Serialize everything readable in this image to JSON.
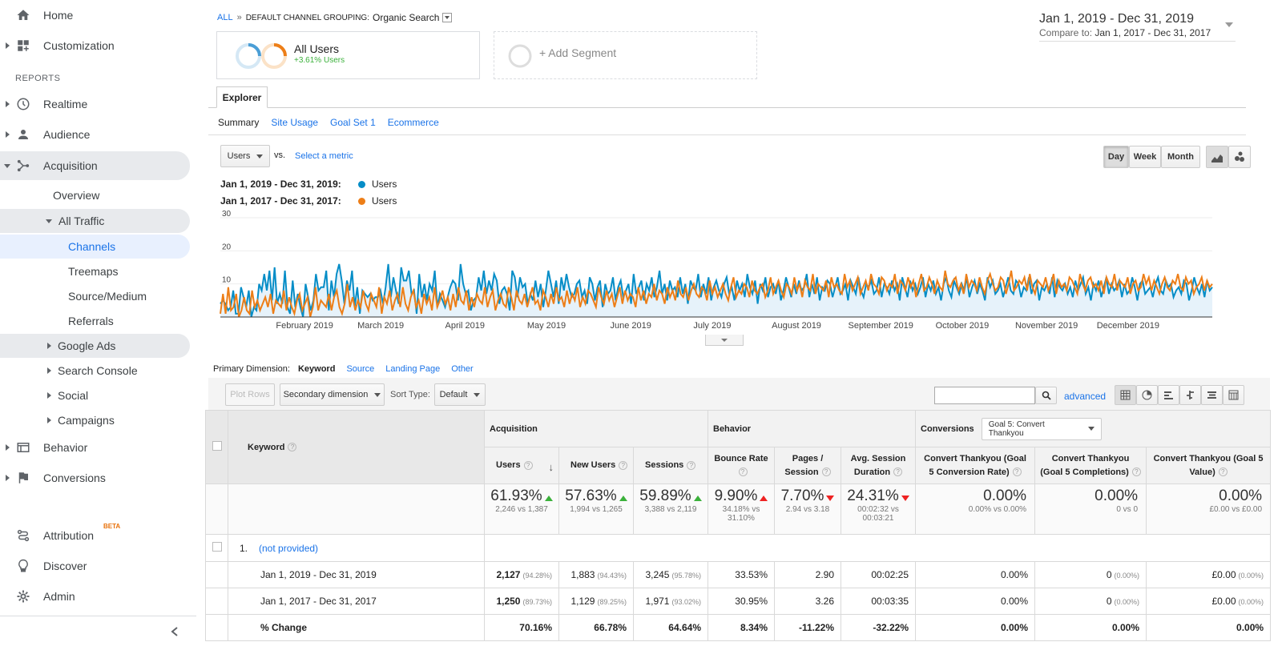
{
  "sidebar": {
    "home": "Home",
    "customization": "Customization",
    "reports_header": "REPORTS",
    "realtime": "Realtime",
    "audience": "Audience",
    "acquisition": "Acquisition",
    "overview": "Overview",
    "all_traffic": "All Traffic",
    "channels": "Channels",
    "treemaps": "Treemaps",
    "source_medium": "Source/Medium",
    "referrals": "Referrals",
    "google_ads": "Google Ads",
    "search_console": "Search Console",
    "social": "Social",
    "campaigns": "Campaigns",
    "behavior": "Behavior",
    "conversions": "Conversions",
    "attribution": "Attribution",
    "attribution_badge": "BETA",
    "discover": "Discover",
    "admin": "Admin"
  },
  "breadcrumb": {
    "all": "ALL",
    "sep": "»",
    "grouping_label": "DEFAULT CHANNEL GROUPING:",
    "grouping_value": "Organic Search"
  },
  "segment": {
    "name": "All Users",
    "pct": "+3.61% Users",
    "add": "+ Add Segment"
  },
  "daterange": {
    "main": "Jan 1, 2019 - Dec 31, 2019",
    "compare_label": "Compare to:",
    "compare_value": "Jan 1, 2017 - Dec 31, 2017"
  },
  "tabs": {
    "explorer": "Explorer",
    "summary": "Summary",
    "site_usage": "Site Usage",
    "goal_set": "Goal Set 1",
    "ecommerce": "Ecommerce"
  },
  "controls": {
    "metric": "Users",
    "vs": "vs.",
    "select_metric": "Select a metric",
    "day": "Day",
    "week": "Week",
    "month": "Month"
  },
  "legend": {
    "range1": "Jan 1, 2019 - Dec 31, 2019:",
    "range2": "Jan 1, 2017 - Dec 31, 2017:",
    "series1": "Users",
    "series2": "Users",
    "color1": "#058dc7",
    "color2": "#ed7e17"
  },
  "chart_data": {
    "type": "line",
    "x_tick_labels": [
      "February 2019",
      "March 2019",
      "April 2019",
      "May 2019",
      "June 2019",
      "July 2019",
      "August 2019",
      "September 2019",
      "October 2019",
      "November 2019",
      "December 2019"
    ],
    "y_tick_labels": [
      "30",
      "20",
      "10"
    ],
    "ylim": [
      0,
      30
    ],
    "series": [
      {
        "name": "Users",
        "color": "#058dc7",
        "values": [
          4,
          5,
          4,
          2,
          3,
          8,
          1,
          1,
          9,
          6,
          3,
          8,
          0,
          3,
          2,
          10,
          8,
          13,
          8,
          14,
          5,
          15,
          4,
          7,
          4,
          14,
          3,
          1,
          11,
          3,
          7,
          3,
          0,
          10,
          6,
          2,
          5,
          13,
          8,
          9,
          9,
          14,
          2,
          11,
          6,
          13,
          16,
          11,
          4,
          11,
          8,
          14,
          3,
          9,
          1,
          8,
          7,
          6,
          7,
          5,
          6,
          6,
          8,
          4,
          9,
          16,
          6,
          12,
          8,
          4,
          15,
          11,
          11,
          14,
          7,
          8,
          1,
          13,
          6,
          10,
          5,
          10,
          8,
          14,
          3,
          7,
          5,
          3,
          6,
          9,
          11,
          10,
          5,
          16,
          10,
          7,
          8,
          2,
          5,
          6,
          12,
          8,
          14,
          7,
          11,
          8,
          13,
          11,
          4,
          8,
          9,
          7,
          2,
          14,
          12,
          6,
          12,
          9,
          10,
          4,
          7,
          5,
          11,
          6,
          10,
          3,
          8,
          14,
          10,
          6,
          11,
          4,
          12,
          8,
          13,
          9,
          6,
          7,
          10,
          11,
          6,
          8,
          4,
          12,
          10,
          5,
          9,
          11,
          3,
          10,
          7,
          8,
          12,
          5,
          9,
          11,
          6,
          8,
          10,
          4,
          13,
          7,
          9,
          11,
          5,
          10,
          8,
          12,
          6,
          9,
          14,
          7,
          10,
          5,
          11,
          8,
          9,
          6,
          12,
          7,
          10,
          4,
          11,
          9,
          8,
          13,
          6,
          10,
          7,
          12,
          5,
          9,
          11,
          8,
          6,
          10,
          12,
          7,
          9,
          5,
          11,
          8,
          10,
          6,
          13,
          9,
          7,
          11,
          4,
          10,
          8,
          12,
          6,
          9,
          10,
          7,
          11,
          5,
          8,
          12,
          9,
          6,
          10,
          7,
          11,
          8,
          9,
          13,
          6,
          10,
          7,
          12,
          5,
          9,
          8,
          11,
          10,
          6,
          9,
          12,
          7,
          8,
          10,
          5,
          11,
          9,
          7,
          12,
          8,
          6,
          10,
          9,
          11,
          7,
          8,
          12,
          6,
          10,
          9,
          7,
          11,
          8,
          10,
          5,
          12,
          9,
          6,
          11,
          8,
          10,
          7,
          9,
          12,
          6,
          10,
          8,
          11,
          7,
          9,
          5,
          10,
          12,
          8,
          6,
          11,
          9,
          7,
          10,
          8,
          12,
          6,
          9,
          11,
          7,
          10,
          8,
          5,
          12,
          9,
          11,
          7,
          8,
          10,
          6,
          9,
          12,
          8,
          7,
          11,
          10,
          6,
          9,
          8,
          12,
          7,
          10,
          11,
          5,
          9,
          8,
          10,
          7,
          12,
          6,
          11,
          9,
          8,
          10,
          7,
          9,
          6,
          11,
          8,
          10,
          12,
          7,
          9,
          5,
          10,
          8,
          11,
          6,
          9,
          12,
          7,
          10,
          8,
          9,
          11,
          6,
          10,
          7,
          8,
          12,
          9,
          5,
          10,
          11,
          7,
          8,
          9,
          6,
          10,
          12,
          8,
          7,
          11,
          9,
          10,
          6,
          8,
          9,
          7,
          11,
          10,
          5,
          8,
          12,
          9,
          7,
          10,
          6,
          11,
          8,
          9
        ]
      },
      {
        "name": "Users",
        "color": "#ed7e17",
        "values": [
          1,
          7,
          1,
          9,
          2,
          3,
          7,
          0,
          2,
          6,
          2,
          1,
          8,
          3,
          5,
          2,
          4,
          6,
          3,
          7,
          1,
          5,
          4,
          3,
          8,
          2,
          6,
          3,
          1,
          5,
          7,
          2,
          4,
          6,
          0,
          3,
          9,
          2,
          5,
          4,
          3,
          7,
          2,
          6,
          8,
          3,
          1,
          4,
          10,
          3,
          6,
          2,
          5,
          3,
          8,
          4,
          2,
          7,
          5,
          3,
          9,
          1,
          6,
          4,
          8,
          2,
          5,
          7,
          3,
          9,
          4,
          2,
          6,
          8,
          3,
          5,
          1,
          7,
          4,
          6,
          2,
          9,
          3,
          5,
          8,
          4,
          6,
          2,
          7,
          3,
          9,
          5,
          4,
          8,
          2,
          6,
          3,
          7,
          5,
          4,
          9,
          3,
          6,
          8,
          2,
          5,
          7,
          4,
          3,
          9,
          6,
          2,
          8,
          5,
          4,
          7,
          3,
          6,
          9,
          4,
          5,
          2,
          8,
          6,
          3,
          7,
          4,
          9,
          5,
          6,
          3,
          8,
          4,
          7,
          5,
          9,
          3,
          6,
          4,
          8,
          7,
          5,
          3,
          9,
          6,
          4,
          8,
          5,
          7,
          3,
          6,
          9,
          4,
          8,
          5,
          7,
          6,
          3,
          9,
          5,
          8,
          4,
          7,
          6,
          10,
          5,
          8,
          7,
          4,
          9,
          6,
          8,
          5,
          11,
          7,
          6,
          9,
          5,
          8,
          10,
          7,
          6,
          9,
          8,
          5,
          11,
          7,
          9,
          6,
          8,
          10,
          7,
          5,
          9,
          12,
          6,
          8,
          7,
          10,
          9,
          6,
          11,
          8,
          7,
          9,
          10,
          6,
          8,
          12,
          7,
          9,
          11,
          8,
          6,
          10,
          9,
          7,
          12,
          8,
          10,
          6,
          11,
          9,
          8,
          13,
          7,
          10,
          9,
          8,
          11,
          6,
          12,
          9,
          10,
          8,
          7,
          13,
          9,
          11,
          8,
          10,
          12,
          7,
          9,
          11,
          8,
          13,
          10,
          9,
          7,
          12,
          11,
          8,
          10,
          9,
          13,
          7,
          11,
          10,
          8,
          12,
          9,
          11,
          6,
          10,
          13,
          8,
          9,
          12,
          10,
          7,
          11,
          9,
          8,
          14,
          10,
          9,
          11,
          12,
          8,
          10,
          7,
          13,
          9,
          11,
          10,
          8,
          12,
          9,
          7,
          11,
          13,
          10,
          8,
          9,
          12,
          11,
          7,
          10,
          14,
          8,
          9,
          11,
          10,
          12,
          8,
          13,
          9,
          7,
          11,
          10,
          9,
          12,
          8,
          10,
          13,
          7,
          11,
          9,
          10,
          8,
          12,
          11,
          9,
          7,
          13,
          10,
          8,
          11,
          12,
          9,
          10,
          8,
          11,
          7,
          12,
          10,
          9,
          13,
          8,
          11,
          10,
          9,
          12,
          7,
          10,
          11,
          8,
          9,
          13,
          10,
          12,
          8,
          11,
          9,
          7,
          10,
          12,
          9,
          8,
          11,
          10,
          13,
          9,
          8,
          12,
          10,
          11,
          7,
          9,
          10,
          12,
          8,
          11,
          9,
          10
        ]
      }
    ]
  },
  "dimension": {
    "label": "Primary Dimension:",
    "keyword": "Keyword",
    "source": "Source",
    "landing_page": "Landing Page",
    "other": "Other"
  },
  "toolbar": {
    "plot_rows": "Plot Rows",
    "secondary": "Secondary dimension",
    "sort_type": "Sort Type:",
    "default": "Default",
    "advanced": "advanced"
  },
  "table": {
    "keyword_header": "Keyword",
    "acquisition": "Acquisition",
    "behavior": "Behavior",
    "conversions": "Conversions",
    "goal_select": "Goal 5: Convert Thankyou",
    "cols": [
      "Users",
      "New Users",
      "Sessions",
      "Bounce Rate",
      "Pages / Session",
      "Avg. Session Duration",
      "Convert Thankyou (Goal 5 Conversion Rate)",
      "Convert Thankyou (Goal 5 Completions)",
      "Convert Thankyou (Goal 5 Value)"
    ],
    "totals": [
      {
        "pct": "61.93%",
        "sub": "2,246 vs 1,387"
      },
      {
        "pct": "57.63%",
        "sub": "1,994 vs 1,265"
      },
      {
        "pct": "59.89%",
        "sub": "3,388 vs 2,119"
      },
      {
        "pct": "9.90%",
        "sub": "34.18% vs 31.10%"
      },
      {
        "pct": "7.70%",
        "sub": "2.94 vs 3.18"
      },
      {
        "pct": "24.31%",
        "sub": "00:02:32 vs 00:03:21"
      },
      {
        "pct": "0.00%",
        "sub": "0.00% vs 0.00%"
      },
      {
        "pct": "0.00%",
        "sub": "0 vs 0"
      },
      {
        "pct": "0.00%",
        "sub": "£0.00 vs £0.00"
      }
    ],
    "row_index": "1.",
    "row_name": "(not provided)",
    "rows": [
      {
        "label": "Jan 1, 2019 - Dec 31, 2019",
        "cells": [
          [
            "2,127",
            "(94.28%)"
          ],
          [
            "1,883",
            "(94.43%)"
          ],
          [
            "3,245",
            "(95.78%)"
          ],
          [
            "33.53%",
            ""
          ],
          [
            "2.90",
            ""
          ],
          [
            "00:02:25",
            ""
          ],
          [
            "0.00%",
            ""
          ],
          [
            "0",
            "(0.00%)"
          ],
          [
            "£0.00",
            "(0.00%)"
          ]
        ]
      },
      {
        "label": "Jan 1, 2017 - Dec 31, 2017",
        "cells": [
          [
            "1,250",
            "(89.73%)"
          ],
          [
            "1,129",
            "(89.25%)"
          ],
          [
            "1,971",
            "(93.02%)"
          ],
          [
            "30.95%",
            ""
          ],
          [
            "3.26",
            ""
          ],
          [
            "00:03:35",
            ""
          ],
          [
            "0.00%",
            ""
          ],
          [
            "0",
            "(0.00%)"
          ],
          [
            "£0.00",
            "(0.00%)"
          ]
        ]
      },
      {
        "label": "% Change",
        "cells": [
          [
            "70.16%",
            ""
          ],
          [
            "66.78%",
            ""
          ],
          [
            "64.64%",
            ""
          ],
          [
            "8.34%",
            ""
          ],
          [
            "-11.22%",
            ""
          ],
          [
            "-32.22%",
            ""
          ],
          [
            "0.00%",
            ""
          ],
          [
            "0.00%",
            ""
          ],
          [
            "0.00%",
            ""
          ]
        ]
      }
    ]
  }
}
